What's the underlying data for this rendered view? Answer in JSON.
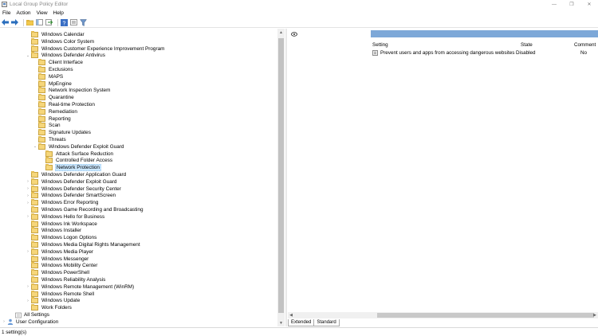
{
  "window": {
    "title": "Local Group Policy Editor",
    "minimize_glyph": "—",
    "restore_glyph": "❐",
    "close_glyph": "✕"
  },
  "menu": {
    "items": [
      "File",
      "Action",
      "View",
      "Help"
    ]
  },
  "toolbar": {
    "icons": [
      "back-icon",
      "forward-icon",
      "up-folder-icon",
      "show-hide-tree-icon",
      "export-list-icon",
      "help-icon",
      "properties-icon",
      "filter-icon"
    ]
  },
  "tree": {
    "items": [
      {
        "label": "Windows Calendar",
        "level": 2,
        "expander": ""
      },
      {
        "label": "Windows Color System",
        "level": 2,
        "expander": ""
      },
      {
        "label": "Windows Customer Experience Improvement Program",
        "level": 2,
        "expander": ""
      },
      {
        "label": "Windows Defender Antivirus",
        "level": 2,
        "expander": "v"
      },
      {
        "label": "Client Interface",
        "level": 3,
        "expander": ""
      },
      {
        "label": "Exclusions",
        "level": 3,
        "expander": ""
      },
      {
        "label": "MAPS",
        "level": 3,
        "expander": ""
      },
      {
        "label": "MpEngine",
        "level": 3,
        "expander": ""
      },
      {
        "label": "Network Inspection System",
        "level": 3,
        "expander": ""
      },
      {
        "label": "Quarantine",
        "level": 3,
        "expander": ""
      },
      {
        "label": "Real-time Protection",
        "level": 3,
        "expander": ""
      },
      {
        "label": "Remediation",
        "level": 3,
        "expander": ""
      },
      {
        "label": "Reporting",
        "level": 3,
        "expander": ""
      },
      {
        "label": "Scan",
        "level": 3,
        "expander": ""
      },
      {
        "label": "Signature Updates",
        "level": 3,
        "expander": ""
      },
      {
        "label": "Threats",
        "level": 3,
        "expander": ""
      },
      {
        "label": "Windows Defender Exploit Guard",
        "level": 3,
        "expander": "v"
      },
      {
        "label": "Attack Surface Reduction",
        "level": 4,
        "expander": ""
      },
      {
        "label": "Controlled Folder Access",
        "level": 4,
        "expander": ""
      },
      {
        "label": "Network Protection",
        "level": 4,
        "expander": "",
        "selected": true
      },
      {
        "label": "Windows Defender Application Guard",
        "level": 2,
        "expander": ""
      },
      {
        "label": "Windows Defender Exploit Guard",
        "level": 2,
        "expander": ">"
      },
      {
        "label": "Windows Defender Security Center",
        "level": 2,
        "expander": ">"
      },
      {
        "label": "Windows Defender SmartScreen",
        "level": 2,
        "expander": ">"
      },
      {
        "label": "Windows Error Reporting",
        "level": 2,
        "expander": ">"
      },
      {
        "label": "Windows Game Recording and Broadcasting",
        "level": 2,
        "expander": ""
      },
      {
        "label": "Windows Hello for Business",
        "level": 2,
        "expander": ">"
      },
      {
        "label": "Windows Ink Workspace",
        "level": 2,
        "expander": ""
      },
      {
        "label": "Windows Installer",
        "level": 2,
        "expander": ""
      },
      {
        "label": "Windows Logon Options",
        "level": 2,
        "expander": ""
      },
      {
        "label": "Windows Media Digital Rights Management",
        "level": 2,
        "expander": ""
      },
      {
        "label": "Windows Media Player",
        "level": 2,
        "expander": ">"
      },
      {
        "label": "Windows Messenger",
        "level": 2,
        "expander": ""
      },
      {
        "label": "Windows Mobility Center",
        "level": 2,
        "expander": ""
      },
      {
        "label": "Windows PowerShell",
        "level": 2,
        "expander": ""
      },
      {
        "label": "Windows Reliability Analysis",
        "level": 2,
        "expander": ""
      },
      {
        "label": "Windows Remote Management (WinRM)",
        "level": 2,
        "expander": ">"
      },
      {
        "label": "Windows Remote Shell",
        "level": 2,
        "expander": ""
      },
      {
        "label": "Windows Update",
        "level": 2,
        "expander": ">"
      },
      {
        "label": "Work Folders",
        "level": 2,
        "expander": ""
      },
      {
        "label": "All Settings",
        "level": 1,
        "expander": "",
        "icon": "settings"
      },
      {
        "label": "User Configuration",
        "level": 0,
        "expander": ">",
        "icon": "user"
      }
    ]
  },
  "details": {
    "columns": {
      "setting": "Setting",
      "state": "State",
      "comment": "Comment"
    },
    "rows": [
      {
        "setting": "Prevent users and apps from accessing dangerous websites",
        "state": "Disabled",
        "comment": "No"
      }
    ],
    "tabs": [
      "Extended",
      "Standard"
    ]
  },
  "status": {
    "text": "1 setting(s)"
  },
  "colors": {
    "header_band": "#7da8d8",
    "selection": "#cce8ff",
    "folder": "#f6d67a"
  }
}
